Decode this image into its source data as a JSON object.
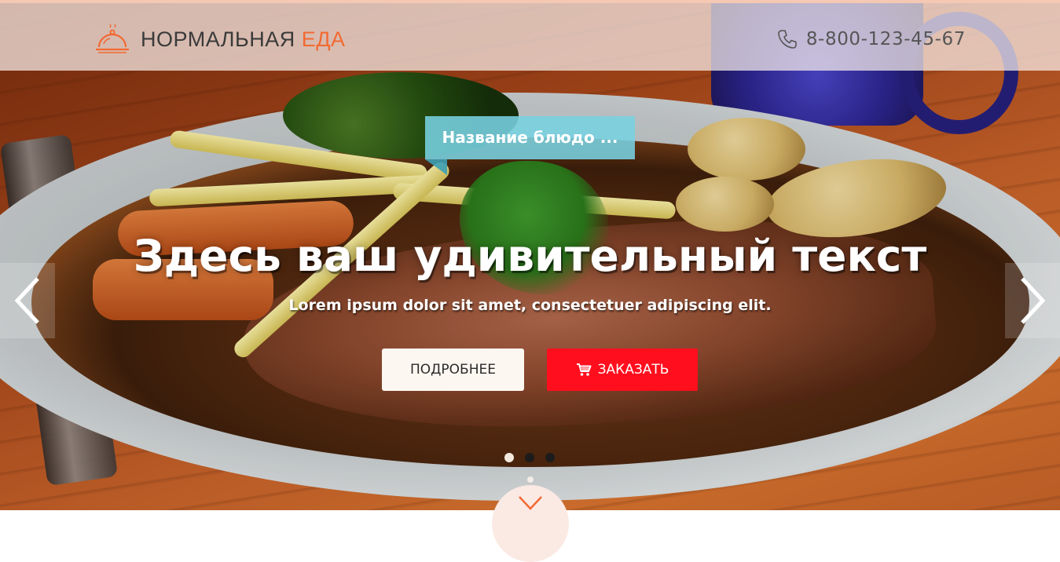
{
  "header": {
    "logo_text": "НОРМАЛЬНАЯ",
    "logo_accent": "ЕДА",
    "phone": "8-800-123-45-67",
    "logo_icon": "cloche-icon",
    "phone_icon": "phone-icon"
  },
  "slide": {
    "dish_label": "Название блюдо ...",
    "headline": "Здесь ваш удивительный текст",
    "subline": "Lorem ipsum dolor sit amet, consectetuer adipiscing elit.",
    "more_button": "ПОДРОБНЕЕ",
    "order_button": "ЗАКАЗАТЬ",
    "order_icon": "cart-icon"
  },
  "carousel": {
    "slide_count": 3,
    "active_slide": 1,
    "prev_icon": "chevron-left-icon",
    "next_icon": "chevron-right-icon",
    "scroll_icon": "chevron-down-icon"
  },
  "colors": {
    "accent": "#f26a32",
    "order_button": "#ff0f1e",
    "label_bg": "#78d2e1",
    "header_bg": "#faf0ed"
  }
}
